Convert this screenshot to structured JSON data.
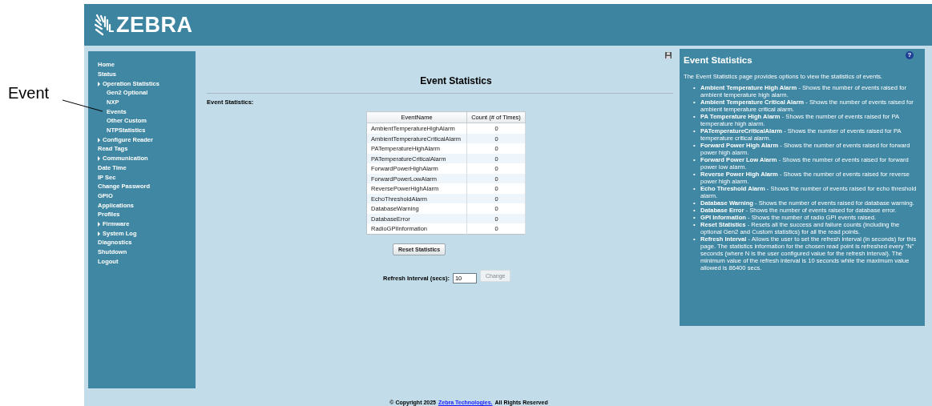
{
  "callout": {
    "label": "Event"
  },
  "header": {
    "brand": "ZEBRA"
  },
  "sidebar": {
    "items": [
      {
        "label": "Home",
        "kind": "link"
      },
      {
        "label": "Status",
        "kind": "link"
      },
      {
        "label": "Operation Statistics",
        "kind": "group",
        "children": [
          {
            "label": "Gen2 Optional"
          },
          {
            "label": "NXP"
          },
          {
            "label": "Events"
          },
          {
            "label": "Other Custom"
          },
          {
            "label": "NTPStatistics"
          }
        ]
      },
      {
        "label": "Configure Reader",
        "kind": "group"
      },
      {
        "label": "Read Tags",
        "kind": "link"
      },
      {
        "label": "Communication",
        "kind": "group"
      },
      {
        "label": "Date Time",
        "kind": "link"
      },
      {
        "label": "IP Sec",
        "kind": "link"
      },
      {
        "label": "Change Password",
        "kind": "link"
      },
      {
        "label": "GPIO",
        "kind": "link"
      },
      {
        "label": "Applications",
        "kind": "link"
      },
      {
        "label": "Profiles",
        "kind": "link"
      },
      {
        "label": "Firmware",
        "kind": "group"
      },
      {
        "label": "System Log",
        "kind": "group"
      },
      {
        "label": "Diagnostics",
        "kind": "link"
      },
      {
        "label": "Shutdown",
        "kind": "link"
      },
      {
        "label": "Logout",
        "kind": "link"
      }
    ]
  },
  "main": {
    "title": "Event Statistics",
    "section_label": "Event Statistics:",
    "table": {
      "columns": [
        "EventName",
        "Count (# of Times)"
      ],
      "rows": [
        [
          "AmbientTemperatureHighAlarm",
          "0"
        ],
        [
          "AmbientTemperatureCriticalAlarm",
          "0"
        ],
        [
          "PATemperatureHighAlarm",
          "0"
        ],
        [
          "PATemperatureCriticalAlarm",
          "0"
        ],
        [
          "ForwardPowerHighAlarm",
          "0"
        ],
        [
          "ForwardPowerLowAlarm",
          "0"
        ],
        [
          "ReversePowerHighAlarm",
          "0"
        ],
        [
          "EchoThresholdAlarm",
          "0"
        ],
        [
          "DatabaseWarning",
          "0"
        ],
        [
          "DatabaseError",
          "0"
        ],
        [
          "RadioGPIInformation",
          "0"
        ]
      ]
    },
    "reset_button": "Reset Statistics",
    "refresh": {
      "label": "Refresh Interval (secs):",
      "value": "10",
      "button": {
        "label": "Change",
        "disabled": true
      }
    }
  },
  "help": {
    "button": "?",
    "title": "Event Statistics",
    "intro": "The Event Statistics page provides options to view the statistics of events.",
    "items": [
      {
        "bullet": "•",
        "text": "**Ambient Temperature High Alarm** - Shows the number of events raised for ambient temperature high alarm."
      },
      {
        "bullet": "•",
        "text": "**Ambient Temperature Critical Alarm** - Shows the number of events raised for ambient temperature critical alarm."
      },
      {
        "bullet": "•",
        "text": "**PA Temperature High Alarm** - Shows the number of events raised for PA temperature high alarm."
      },
      {
        "bullet": "•",
        "text": "**PATemperatureCriticalAlarm** - Shows the number of events raised for PA temperature critical alarm."
      },
      {
        "bullet": "•",
        "text": "**Forward Power High Alarm** - Shows the number of events raised for forward power high alarm."
      },
      {
        "bullet": "•",
        "text": "**Forward Power Low Alarm** - Shows the number of events raised for forward power low alarm."
      },
      {
        "bullet": "•",
        "text": "**Reverse Power High Alarm** - Shows the number of events raised for reverse power high alarm."
      },
      {
        "bullet": "•",
        "text": "**Echo Threshold Alarm** - Shows the number of events raised for echo threshold alarm."
      },
      {
        "bullet": "•",
        "text": "**Database Warning** - Shows the number of events raised for database warning."
      },
      {
        "bullet": "•",
        "text": "**Database Error** - Shows the number of events raised for database error."
      },
      {
        "bullet": "•",
        "text": "**GPI Information** - Shows the number of radio GPI events raised."
      },
      {
        "bullet": "•",
        "text": "**Reset Statistics** - Resets all the success and failure counts (including the optional Gen2 and Custom statistics) for all the read points."
      },
      {
        "bullet": "•",
        "text": "**Refresh Interval** - Allows the user to set the refresh interval (in seconds) for this page. The statistics information for the chosen read point is refreshed every \"N\" seconds (where N is the user configured value for the refresh interval). The minimum value of the refresh interval is 10 seconds while the maximum value allowed is 86400 secs."
      }
    ]
  },
  "footer": {
    "prefix": "© Copyright 2025",
    "link": "Zebra Technologies.",
    "suffix": "All Rights Reserved"
  }
}
